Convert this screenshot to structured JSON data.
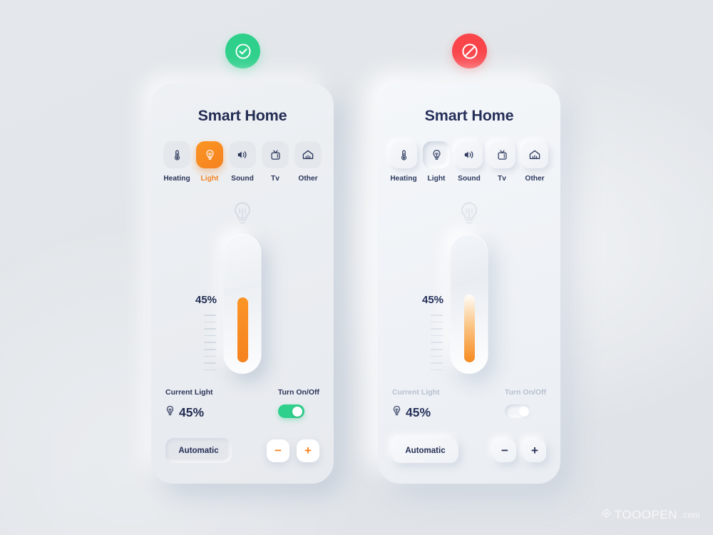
{
  "theme": {
    "background": "#e3e7eb",
    "accent_orange": "#f5821f",
    "accent_green": "#2ed08b",
    "accent_red": "#f9444a",
    "text_navy": "#232d53"
  },
  "badges": [
    {
      "name": "check-circle-icon",
      "state": "enabled",
      "color": "#2ed08b"
    },
    {
      "name": "prohibited-icon",
      "state": "disabled",
      "color": "#f9444a"
    }
  ],
  "cards": [
    {
      "id": "enabled-card",
      "title": "Smart Home",
      "categories": [
        {
          "label": "Heating",
          "icon": "thermometer-icon",
          "active": false
        },
        {
          "label": "Light",
          "icon": "bulb-icon",
          "active": true
        },
        {
          "label": "Sound",
          "icon": "speaker-icon",
          "active": false
        },
        {
          "label": "Tv",
          "icon": "tv-icon",
          "active": false
        },
        {
          "label": "Other",
          "icon": "home-icon",
          "active": false
        }
      ],
      "hero_icon": "bulb-outline-icon",
      "slider": {
        "value_label": "45%",
        "value": 45,
        "min": 0,
        "max": 100,
        "ticks": 9
      },
      "current_label": "Current Light",
      "current_value": "45%",
      "toggle_label": "Turn On/Off",
      "toggle_on": true,
      "auto_label": "Automatic",
      "decrease_label": "−",
      "increase_label": "+"
    },
    {
      "id": "disabled-card",
      "title": "Smart Home",
      "categories": [
        {
          "label": "Heating",
          "icon": "thermometer-icon",
          "active": false
        },
        {
          "label": "Light",
          "icon": "bulb-icon",
          "active": true
        },
        {
          "label": "Sound",
          "icon": "speaker-icon",
          "active": false
        },
        {
          "label": "Tv",
          "icon": "tv-icon",
          "active": false
        },
        {
          "label": "Other",
          "icon": "home-icon",
          "active": false
        }
      ],
      "hero_icon": "bulb-outline-icon",
      "slider": {
        "value_label": "45%",
        "value": 45,
        "min": 0,
        "max": 100,
        "ticks": 9
      },
      "current_label": "Current Light",
      "current_value": "45%",
      "toggle_label": "Turn On/Off",
      "toggle_on": false,
      "auto_label": "Automatic",
      "decrease_label": "−",
      "increase_label": "+"
    }
  ],
  "watermark": {
    "main": "TOOOPEN",
    "suffix": ".com"
  }
}
